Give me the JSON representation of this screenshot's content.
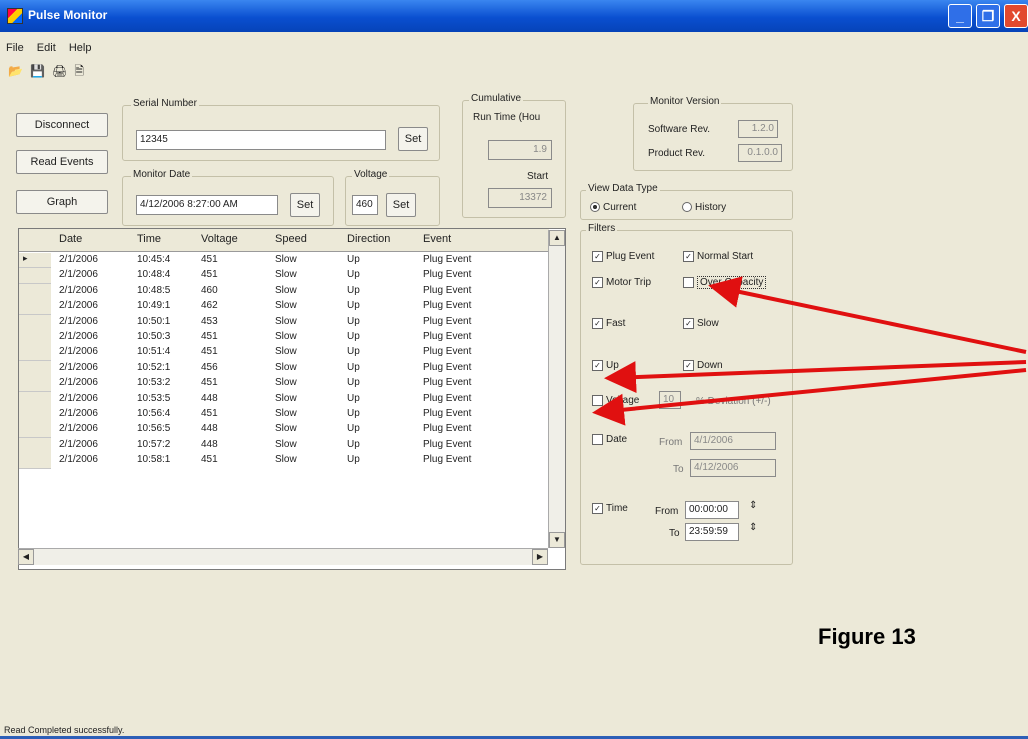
{
  "window": {
    "title": "Pulse Monitor",
    "minimize": "_",
    "maximize": "❐",
    "close": "X"
  },
  "menu": [
    "File",
    "Edit",
    "Help"
  ],
  "toolbar_icons": [
    "open-icon",
    "save-icon",
    "print-icon",
    "print-preview-icon"
  ],
  "buttons": {
    "disconnect": "Disconnect",
    "read_events": "Read Events",
    "graph": "Graph"
  },
  "serial": {
    "legend": "Serial Number",
    "value": "12345",
    "set": "Set"
  },
  "monitor_date": {
    "legend": "Monitor Date",
    "value": "4/12/2006 8:27:00 AM",
    "set": "Set"
  },
  "voltage": {
    "legend": "Voltage",
    "value": "460",
    "set": "Set"
  },
  "cumulative": {
    "legend": "Cumulative",
    "run_time_label": "Run Time (Hou",
    "run_time_value": "1.9",
    "start_label": "Start",
    "start_value": "13372"
  },
  "monitor_version": {
    "legend": "Monitor Version",
    "software_label": "Software Rev.",
    "software_value": "1.2.0",
    "product_label": "Product Rev.",
    "product_value": "0.1.0.0"
  },
  "view_type": {
    "legend": "View Data Type",
    "current": "Current",
    "history": "History",
    "selected": "Current"
  },
  "filters": {
    "legend": "Filters",
    "plug_event": "Plug Event",
    "normal_start": "Normal Start",
    "motor_trip": "Motor Trip",
    "over_capacity": "Over Capacity",
    "fast": "Fast",
    "slow": "Slow",
    "up": "Up",
    "down": "Down",
    "voltage": "Voltage",
    "voltage_value": "10",
    "deviation": "% Deviation (+/-)",
    "date": "Date",
    "from": "From",
    "to": "To",
    "date_from": "4/1/2006",
    "date_to": "4/12/2006",
    "time": "Time",
    "time_from": "00:00:00",
    "time_to": "23:59:59"
  },
  "table": {
    "columns": [
      "Date",
      "Time",
      "Voltage",
      "Speed",
      "Direction",
      "Event"
    ],
    "rows": [
      [
        "2/1/2006",
        "10:45:4",
        "451",
        "Slow",
        "Up",
        "Plug Event"
      ],
      [
        "2/1/2006",
        "10:48:4",
        "451",
        "Slow",
        "Up",
        "Plug Event"
      ],
      [
        "2/1/2006",
        "10:48:5",
        "460",
        "Slow",
        "Up",
        "Plug Event"
      ],
      [
        "2/1/2006",
        "10:49:1",
        "462",
        "Slow",
        "Up",
        "Plug Event"
      ],
      [
        "2/1/2006",
        "10:50:1",
        "453",
        "Slow",
        "Up",
        "Plug Event"
      ],
      [
        "2/1/2006",
        "10:50:3",
        "451",
        "Slow",
        "Up",
        "Plug Event"
      ],
      [
        "2/1/2006",
        "10:51:4",
        "451",
        "Slow",
        "Up",
        "Plug Event"
      ],
      [
        "2/1/2006",
        "10:52:1",
        "456",
        "Slow",
        "Up",
        "Plug Event"
      ],
      [
        "2/1/2006",
        "10:53:2",
        "451",
        "Slow",
        "Up",
        "Plug Event"
      ],
      [
        "2/1/2006",
        "10:53:5",
        "448",
        "Slow",
        "Up",
        "Plug Event"
      ],
      [
        "2/1/2006",
        "10:56:4",
        "451",
        "Slow",
        "Up",
        "Plug Event"
      ],
      [
        "2/1/2006",
        "10:56:5",
        "448",
        "Slow",
        "Up",
        "Plug Event"
      ],
      [
        "2/1/2006",
        "10:57:2",
        "448",
        "Slow",
        "Up",
        "Plug Event"
      ],
      [
        "2/1/2006",
        "10:58:1",
        "451",
        "Slow",
        "Up",
        "Plug Event"
      ]
    ]
  },
  "status": "Read Completed successfully.",
  "figure_label": "Figure 13",
  "colors": {
    "titlebar": "#0a4fd0",
    "arrow": "#e01010",
    "face": "#ece9d8"
  }
}
